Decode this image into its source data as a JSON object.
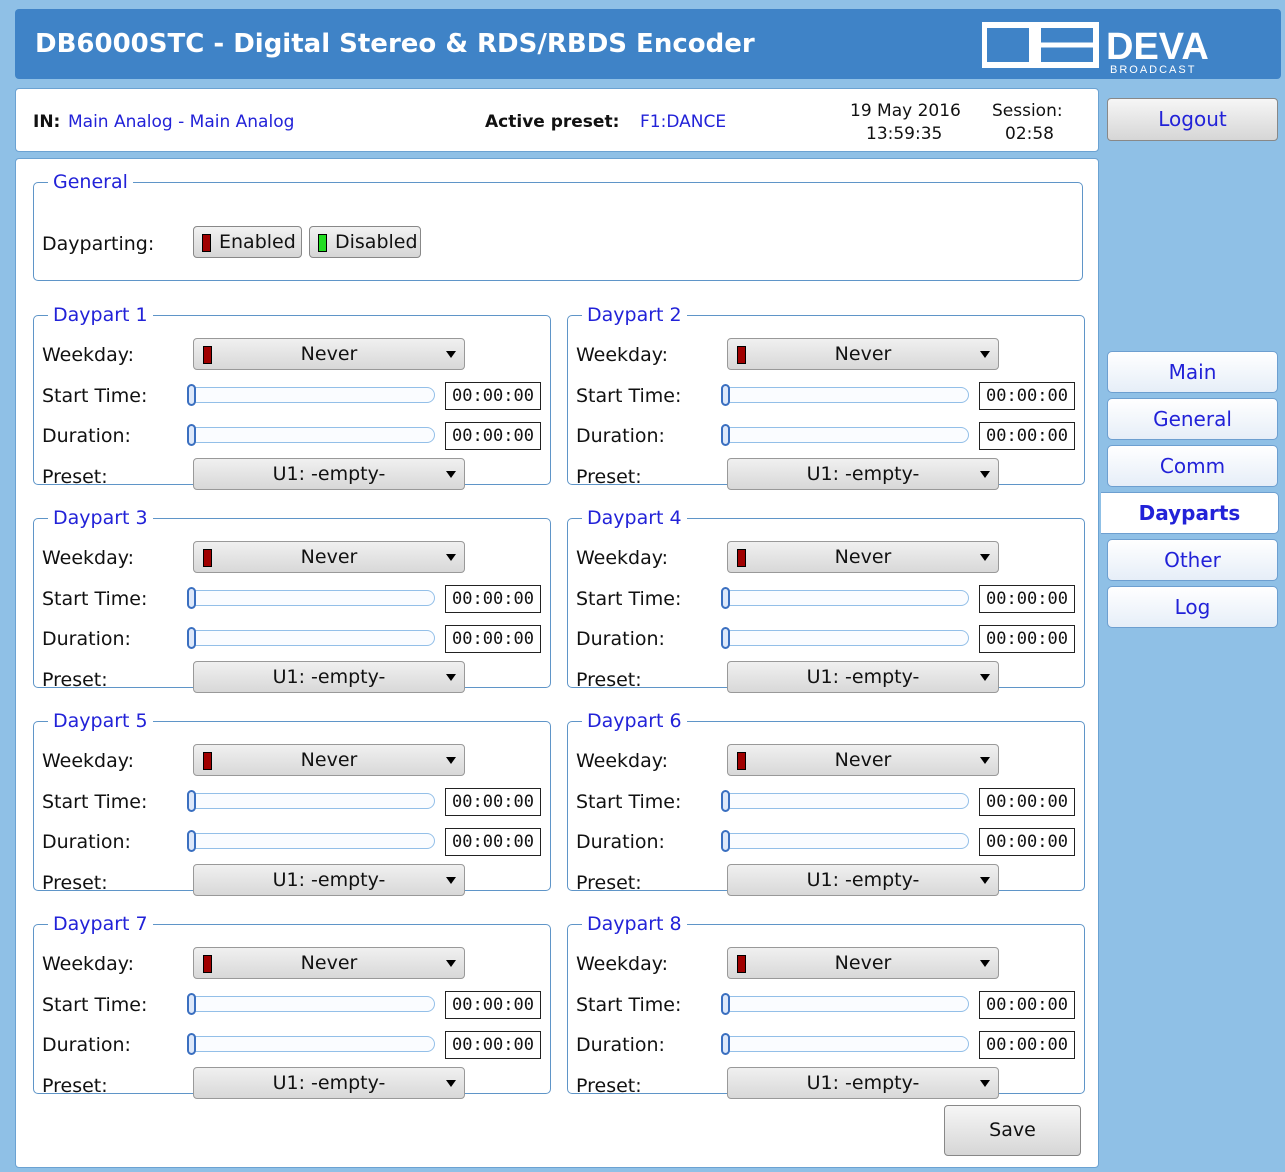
{
  "header": {
    "title": "DB6000STC - Digital Stereo & RDS/RBDS Encoder",
    "logo_text": "DEVA",
    "logo_subtext": "BROADCAST"
  },
  "status": {
    "in_label": "IN:",
    "in_value": "Main Analog - Main Analog",
    "preset_label": "Active preset:",
    "preset_value": "F1:DANCE",
    "date": "19 May 2016",
    "time": "13:59:35",
    "session_label": "Session:",
    "session_value": "02:58"
  },
  "general": {
    "legend": "General",
    "dayparting_label": "Dayparting:",
    "enabled_label": "Enabled",
    "disabled_label": "Disabled"
  },
  "labels": {
    "weekday": "Weekday:",
    "start_time": "Start Time:",
    "duration": "Duration:",
    "preset": "Preset:"
  },
  "dayparts": [
    {
      "legend": "Daypart 1",
      "weekday": "Never",
      "start_time": "00:00:00",
      "duration": "00:00:00",
      "preset": "U1: -empty-"
    },
    {
      "legend": "Daypart 2",
      "weekday": "Never",
      "start_time": "00:00:00",
      "duration": "00:00:00",
      "preset": "U1: -empty-"
    },
    {
      "legend": "Daypart 3",
      "weekday": "Never",
      "start_time": "00:00:00",
      "duration": "00:00:00",
      "preset": "U1: -empty-"
    },
    {
      "legend": "Daypart 4",
      "weekday": "Never",
      "start_time": "00:00:00",
      "duration": "00:00:00",
      "preset": "U1: -empty-"
    },
    {
      "legend": "Daypart 5",
      "weekday": "Never",
      "start_time": "00:00:00",
      "duration": "00:00:00",
      "preset": "U1: -empty-"
    },
    {
      "legend": "Daypart 6",
      "weekday": "Never",
      "start_time": "00:00:00",
      "duration": "00:00:00",
      "preset": "U1: -empty-"
    },
    {
      "legend": "Daypart 7",
      "weekday": "Never",
      "start_time": "00:00:00",
      "duration": "00:00:00",
      "preset": "U1: -empty-"
    },
    {
      "legend": "Daypart 8",
      "weekday": "Never",
      "start_time": "00:00:00",
      "duration": "00:00:00",
      "preset": "U1: -empty-"
    }
  ],
  "save_label": "Save",
  "nav": {
    "logout": "Logout",
    "main": "Main",
    "general": "General",
    "comm": "Comm",
    "dayparts": "Dayparts",
    "other": "Other",
    "log": "Log"
  },
  "colors": {
    "accent": "#3f83c7",
    "background": "#8fc0e6",
    "link": "#2222d8",
    "indicator_red": "#a00000",
    "indicator_green": "#22dd22"
  }
}
